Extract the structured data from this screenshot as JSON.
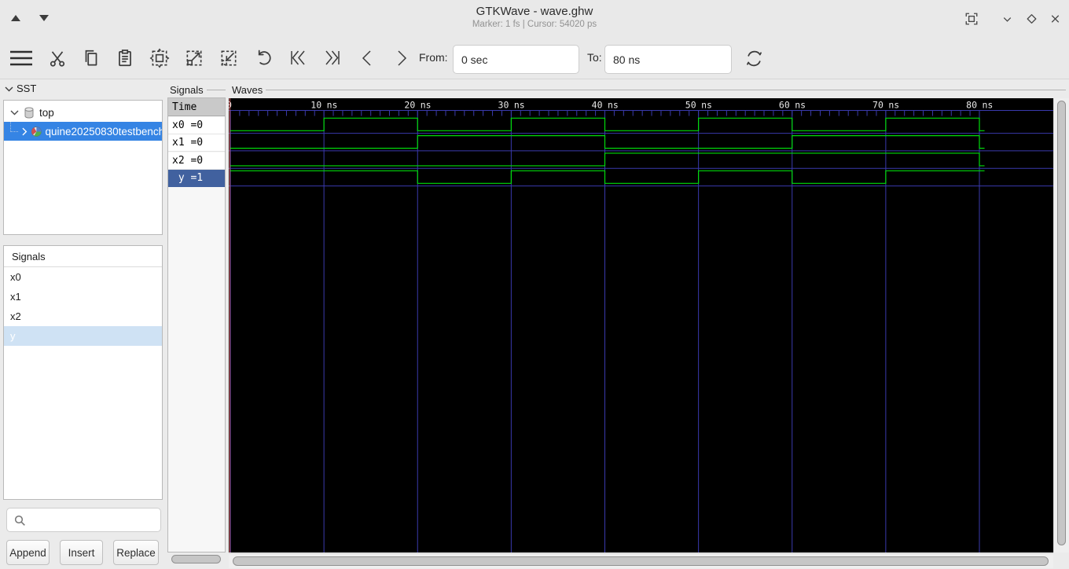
{
  "window": {
    "title": "GTKWave - wave.ghw",
    "subtitle": "Marker: 1 fs  |  Cursor: 54020 ps"
  },
  "toolbar": {
    "from_label": "From:",
    "from_value": "0 sec",
    "to_label": "To:",
    "to_value": "80 ns"
  },
  "sst": {
    "label": "SST",
    "root_item": "top",
    "child_item": "quine20250830testbench"
  },
  "signals_panel": {
    "header": "Signals",
    "items": [
      "x0",
      "x1",
      "x2",
      "y"
    ],
    "selected_item": "y",
    "buttons": [
      "Append",
      "Insert",
      "Replace"
    ]
  },
  "names_column": {
    "label": "Signals",
    "time_header": "Time",
    "rows": [
      "x0 =0",
      "x1 =0",
      "x2 =0",
      " y =1"
    ],
    "selected_index": 3
  },
  "waves": {
    "label": "Waves",
    "timeline": {
      "unit": "ns",
      "start": 0,
      "end": 80,
      "major_step": 10,
      "minor_step": 1
    },
    "data_end": 80.55,
    "signals": [
      {
        "name": "x0",
        "wave": [
          [
            0,
            0
          ],
          [
            10,
            1
          ],
          [
            20,
            0
          ],
          [
            30,
            1
          ],
          [
            40,
            0
          ],
          [
            50,
            1
          ],
          [
            60,
            0
          ],
          [
            70,
            1
          ],
          [
            80,
            0
          ]
        ]
      },
      {
        "name": "x1",
        "wave": [
          [
            0,
            0
          ],
          [
            20,
            1
          ],
          [
            40,
            0
          ],
          [
            60,
            1
          ],
          [
            80,
            0
          ]
        ]
      },
      {
        "name": "x2",
        "wave": [
          [
            0,
            0
          ],
          [
            40,
            1
          ],
          [
            80,
            0
          ]
        ]
      },
      {
        "name": "y",
        "wave": [
          [
            0,
            1
          ],
          [
            20,
            0
          ],
          [
            30,
            1
          ],
          [
            40,
            0
          ],
          [
            50,
            1
          ],
          [
            60,
            0
          ],
          [
            70,
            1
          ]
        ]
      }
    ],
    "colors": {
      "bg": "#000000",
      "trace": "#00dc0a",
      "grid": "#3a3aad",
      "marker": "#ef6a6a",
      "text": "#e8e8e8"
    }
  }
}
